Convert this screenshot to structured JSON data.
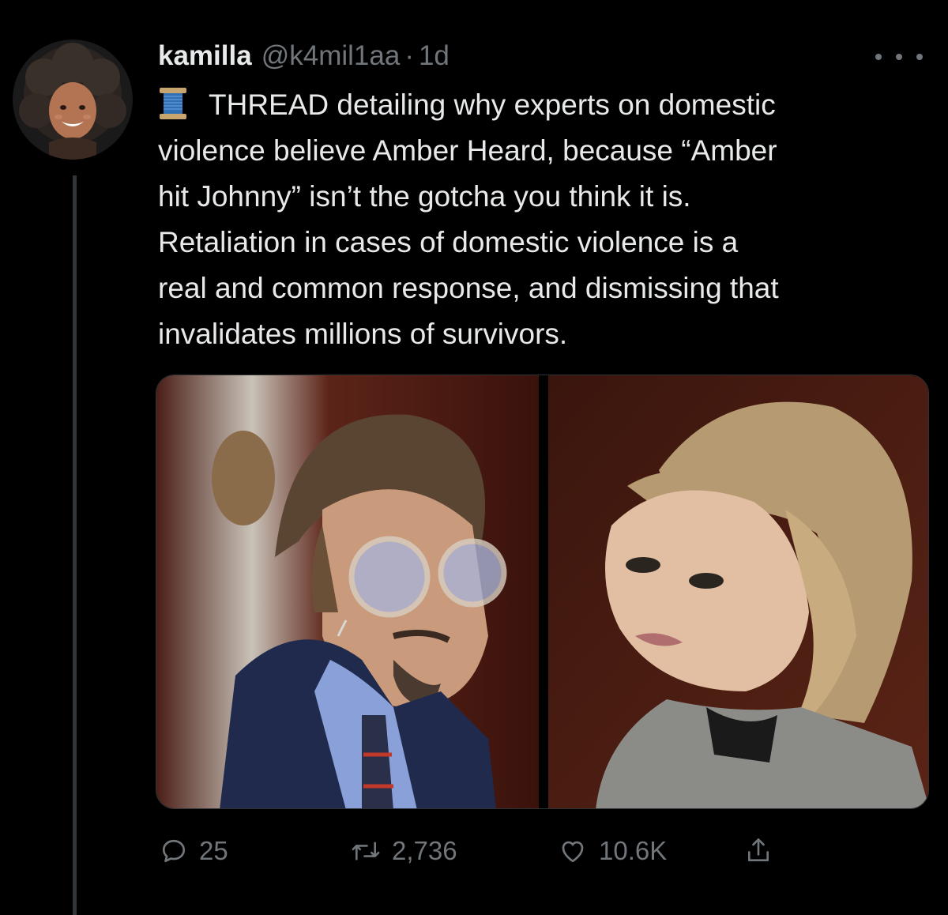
{
  "tweet": {
    "author_name": "kamilla",
    "author_handle": "@k4mil1aa",
    "separator": "·",
    "timestamp": "1d",
    "text_lines": [
      "THREAD detailing why experts on domestic",
      "violence believe Amber Heard, because “Amber",
      "hit Johnny” isn’t the gotcha you think it is.",
      "Retaliation in cases of domestic violence is a",
      "real and common response, and dismissing that",
      "invalidates millions of survivors."
    ],
    "leading_icon": "spool-of-thread-icon"
  },
  "actions": {
    "reply_count": "25",
    "retweet_count": "2,736",
    "like_count": "10.6K",
    "icons": [
      "reply-icon",
      "retweet-icon",
      "like-icon",
      "share-icon"
    ]
  },
  "colors": {
    "background": "#000000",
    "text_primary": "#e7e9ea",
    "text_secondary": "#71767b",
    "thread_line": "#333639"
  }
}
